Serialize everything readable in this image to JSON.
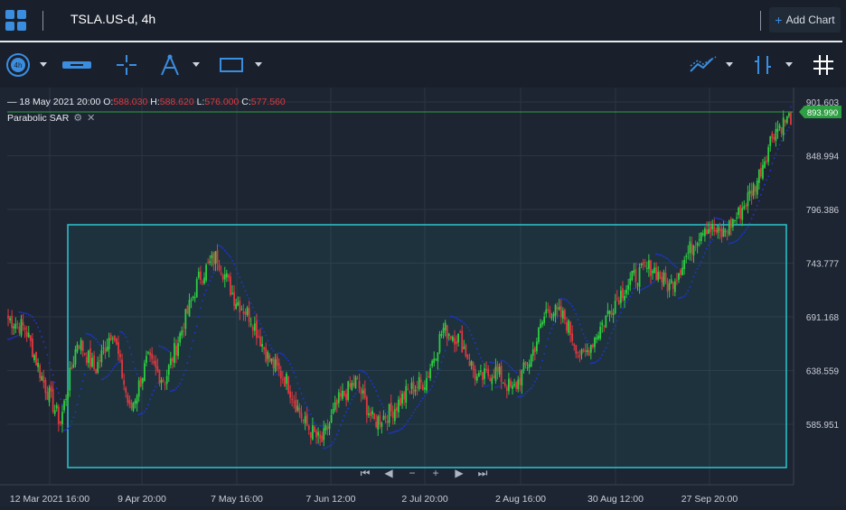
{
  "header": {
    "tab_title": "TSLA.US-d, 4h",
    "add_chart_label": "Add Chart"
  },
  "toolbar": {
    "icons": [
      "timeframe-4h-icon",
      "line-tool-icon",
      "crosshair-icon",
      "fibonacci-tool-icon",
      "rectangle-tool-icon",
      "indicators-icon",
      "chart-style-icon",
      "grid-icon"
    ],
    "timeframe_label": "4h"
  },
  "legend": {
    "date": "18 May 2021 20:00",
    "o_label": "O:",
    "o": "588.030",
    "h_label": "H:",
    "h": "588.620",
    "l_label": "L:",
    "l": "576.000",
    "c_label": "C:",
    "c": "577.560"
  },
  "indicator": {
    "name": "Parabolic SAR"
  },
  "price_axis": {
    "ticks": [
      "901.603",
      "848.994",
      "796.386",
      "743.777",
      "691.168",
      "638.559",
      "585.951"
    ],
    "last_price": "893.990"
  },
  "time_axis": {
    "ticks": [
      "12 Mar 2021 16:00",
      "9 Apr 20:00",
      "7 May 16:00",
      "7 Jun 12:00",
      "2 Jul 20:00",
      "2 Aug 16:00",
      "30 Aug 12:00",
      "27 Sep 20:00"
    ]
  },
  "nav": {
    "first": "⏮",
    "prev": "◀",
    "zoom_out": "−",
    "zoom_in": "+",
    "next": "▶",
    "last": "⏭"
  },
  "chart_data": {
    "type": "candlestick",
    "title": "TSLA.US-d, 4h",
    "ylim": [
      540,
      915
    ],
    "x": [
      "12 Mar 2021 16:00",
      "9 Apr 20:00",
      "7 May 16:00",
      "7 Jun 12:00",
      "2 Jul 20:00",
      "2 Aug 16:00",
      "30 Aug 12:00",
      "27 Sep 20:00"
    ],
    "close_path": [
      700,
      690,
      640,
      600,
      680,
      650,
      690,
      610,
      660,
      640,
      690,
      740,
      760,
      720,
      700,
      660,
      640,
      600,
      580,
      620,
      640,
      600,
      610,
      630,
      640,
      690,
      680,
      640,
      650,
      630,
      660,
      710,
      700,
      660,
      690,
      720,
      740,
      750,
      730,
      760,
      790,
      780,
      800,
      830,
      880,
      894
    ],
    "colors": {
      "up": "#2ecc40",
      "down": "#e0383e",
      "sar": "#1d35d8",
      "selection": "#2ac6cf",
      "last_price": "#2ea043"
    }
  }
}
